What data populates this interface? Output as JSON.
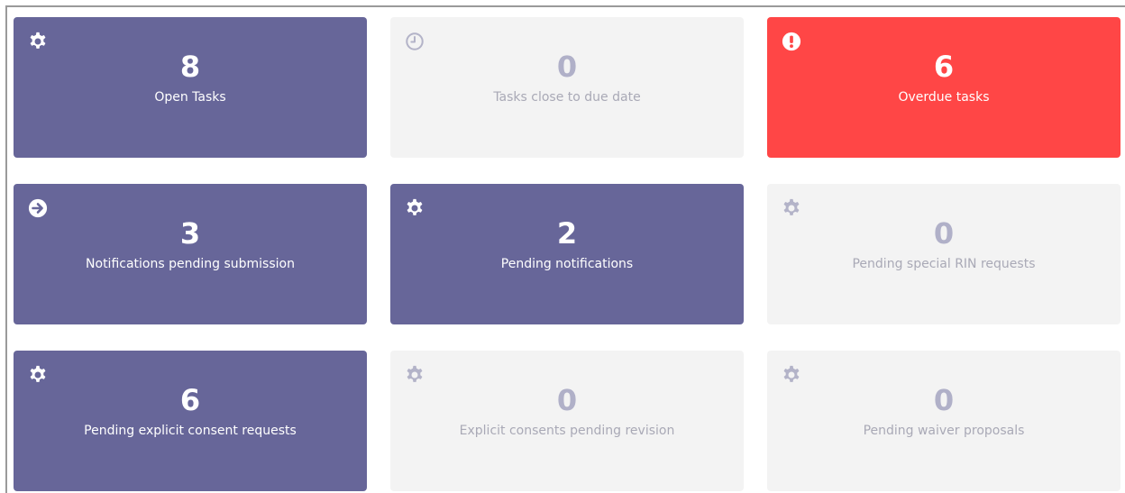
{
  "colors": {
    "purple": "#676699",
    "grey": "#f3f3f3",
    "red": "#ff4646",
    "grey_text": "#adadc3"
  },
  "tiles": [
    {
      "value": "8",
      "label": "Open Tasks",
      "icon": "gear-icon",
      "style": "purple"
    },
    {
      "value": "0",
      "label": "Tasks close to due date",
      "icon": "clock-icon",
      "style": "grey"
    },
    {
      "value": "6",
      "label": "Overdue tasks",
      "icon": "exclamation-circle-icon",
      "style": "red"
    },
    {
      "value": "3",
      "label": "Notifications pending submission",
      "icon": "arrow-right-circle-icon",
      "style": "purple"
    },
    {
      "value": "2",
      "label": "Pending notifications",
      "icon": "gear-icon",
      "style": "purple"
    },
    {
      "value": "0",
      "label": "Pending special RIN requests",
      "icon": "gear-icon",
      "style": "grey"
    },
    {
      "value": "6",
      "label": "Pending explicit consent requests",
      "icon": "gear-icon",
      "style": "purple"
    },
    {
      "value": "0",
      "label": "Explicit consents pending revision",
      "icon": "gear-icon",
      "style": "grey"
    },
    {
      "value": "0",
      "label": "Pending waiver proposals",
      "icon": "gear-icon",
      "style": "grey"
    }
  ]
}
